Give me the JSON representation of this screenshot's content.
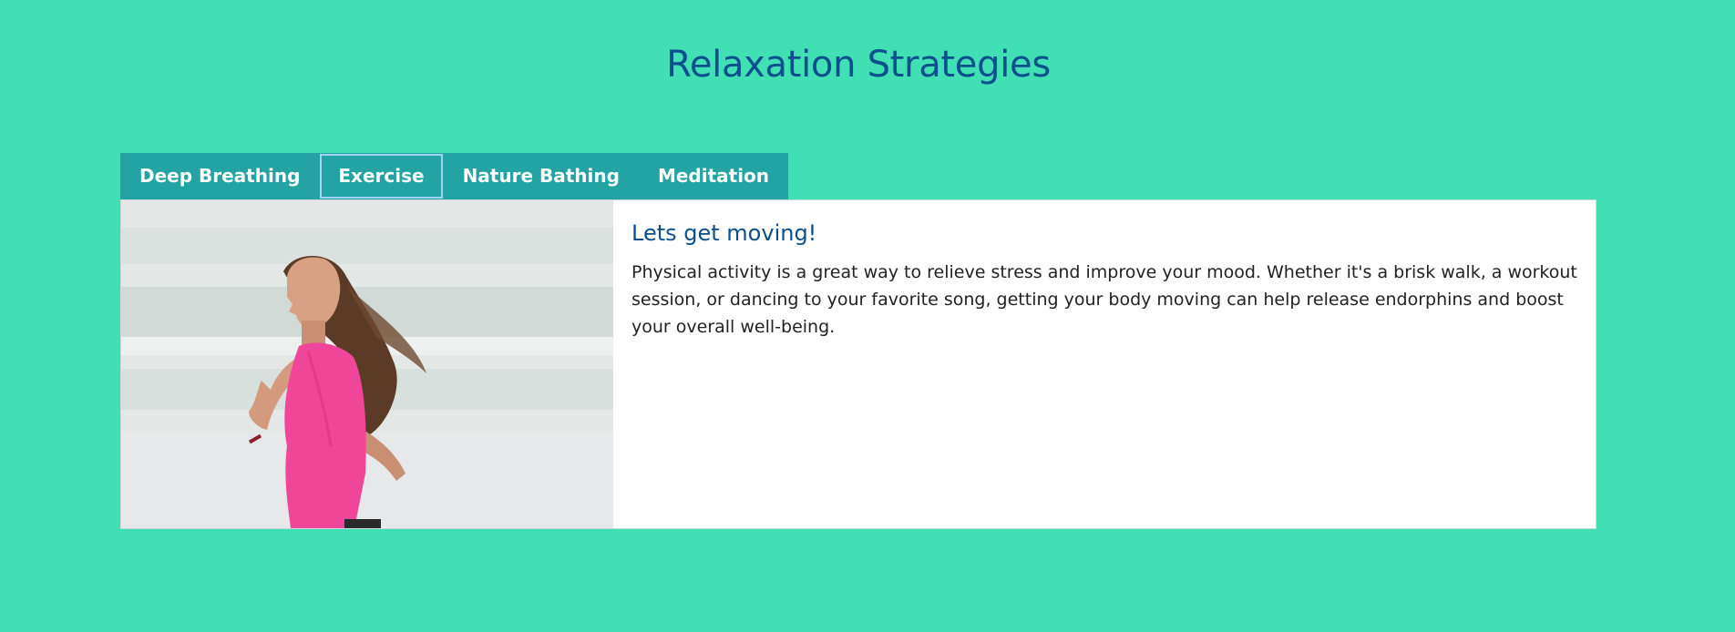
{
  "page": {
    "title": "Relaxation Strategies"
  },
  "tabs": [
    {
      "label": "Deep Breathing",
      "active": false
    },
    {
      "label": "Exercise",
      "active": true
    },
    {
      "label": "Nature Bathing",
      "active": false
    },
    {
      "label": "Meditation",
      "active": false
    }
  ],
  "content": {
    "image_subject": "woman-running-on-beach",
    "heading": "Lets get moving!",
    "body": "Physical activity is a great way to relieve stress and improve your mood. Whether it's a brisk walk, a workout session, or dancing to your favorite song, getting your body moving can help release endorphins and boost your overall well-being."
  },
  "colors": {
    "background": "#40e0b4",
    "tab_bar": "#23a3a3",
    "title": "#0b4f8c",
    "active_tab_outline": "#9fd3f5"
  }
}
